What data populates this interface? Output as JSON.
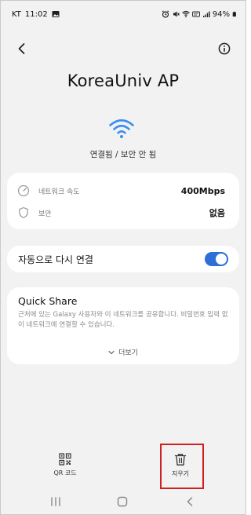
{
  "status_bar": {
    "carrier": "KT",
    "time": "11:02",
    "battery": "94%",
    "icons": [
      "gallery-icon",
      "alarm-icon",
      "mute-icon",
      "wifi-icon",
      "volte-icon",
      "signal-icon",
      "battery-icon"
    ]
  },
  "header": {
    "back_icon": "chevron-left-icon",
    "info_icon": "info-icon"
  },
  "network": {
    "name": "KoreaUniv AP",
    "status": "연결됨 / 보안 안 됨"
  },
  "details": [
    {
      "icon": "gauge-icon",
      "label": "네트워크 속도",
      "value": "400Mbps"
    },
    {
      "icon": "shield-icon",
      "label": "보안",
      "value": "없음"
    }
  ],
  "auto_reconnect": {
    "label": "자동으로 다시 연결",
    "enabled": true
  },
  "quick_share": {
    "title": "Quick Share",
    "description": "근처에 있는 Galaxy 사용자와 이 네트워크를 공유합니다. 비밀번호 입력 없이 네트워크에 연결할 수 있습니다."
  },
  "more": {
    "label": "더보기"
  },
  "actions": [
    {
      "icon": "qr-code-icon",
      "label": "QR 코드"
    },
    {
      "icon": "trash-icon",
      "label": "지우기"
    }
  ],
  "colors": {
    "accent": "#2c6fd8",
    "wifi": "#3a8ff0",
    "background": "#f2f2f2",
    "highlight": "#d21f1f"
  }
}
